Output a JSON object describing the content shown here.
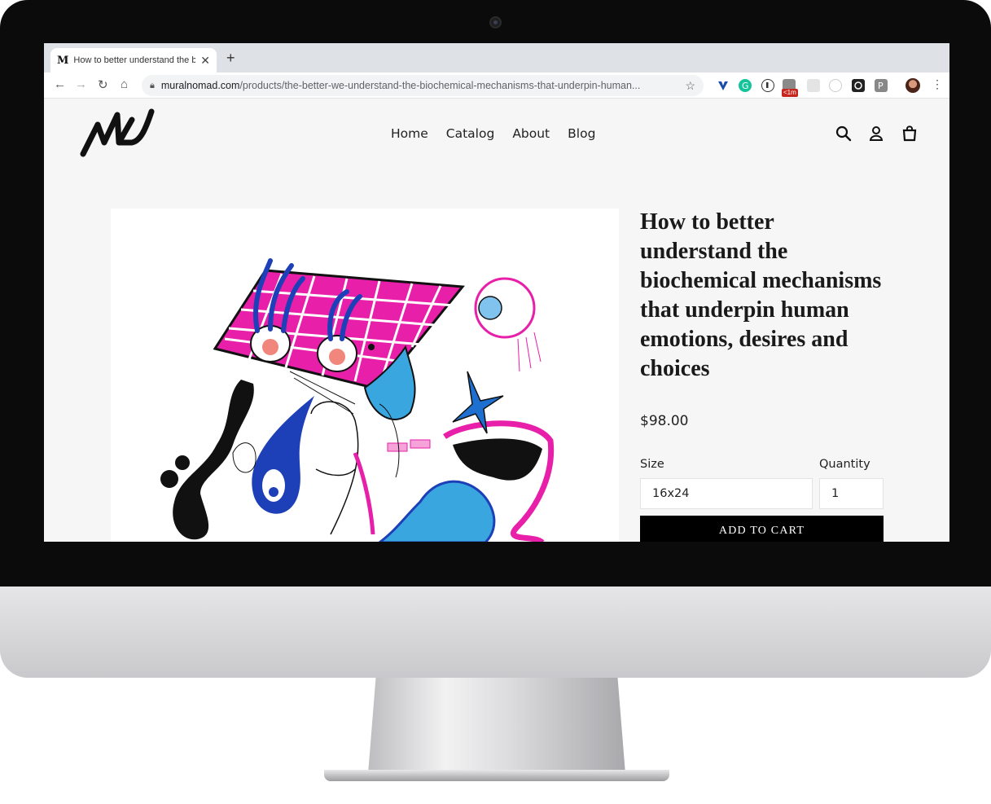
{
  "browser": {
    "tab_title": "How to better understand the b",
    "tab_favicon": "M",
    "tab_close": "✕",
    "new_tab": "+",
    "url_host": "muralnomad.com",
    "url_path": "/products/the-better-we-understand-the-biochemical-mechanisms-that-underpin-human...",
    "extension_badge": "<1m"
  },
  "site": {
    "nav": [
      "Home",
      "Catalog",
      "About",
      "Blog"
    ],
    "product": {
      "title": "How to better understand the biochemical mechanisms that underpin human emotions, desires and choices",
      "price": "$98.00",
      "size_label": "Size",
      "size_value": "16x24",
      "quantity_label": "Quantity",
      "quantity_value": "1",
      "add_to_cart": "ADD TO CART"
    }
  },
  "colors": {
    "accent_magenta": "#e81fa8",
    "accent_blue": "#1d3fb8",
    "accent_cyan": "#3aa6e0",
    "button_black": "#000000"
  }
}
